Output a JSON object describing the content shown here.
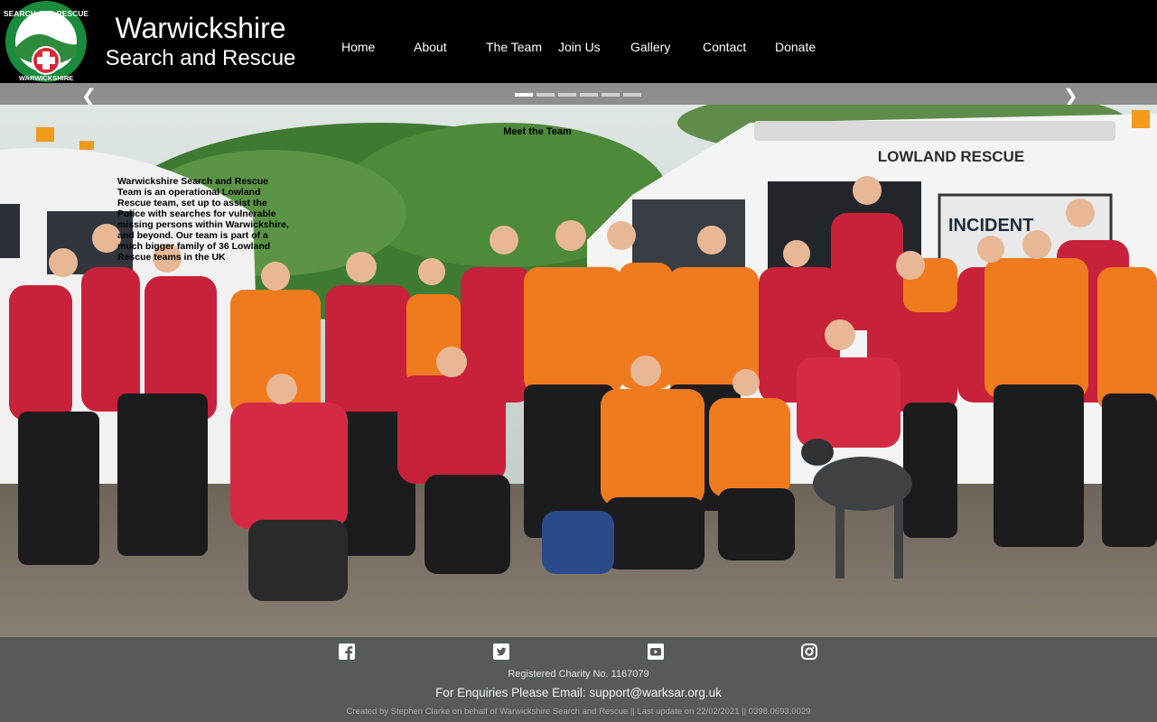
{
  "brand": {
    "line1": "Warwickshire",
    "line2": "Search and Rescue",
    "logo_icon": "search-and-rescue-warwickshire-logo",
    "logo_text_top": "SEARCH AND RESCUE",
    "logo_text_bottom": "WARWICKSHIRE"
  },
  "nav": [
    "Home",
    "About",
    "The Team",
    "Join Us",
    "Gallery",
    "Contact",
    "Donate"
  ],
  "slider": {
    "prev_icon": "chevron-left-icon",
    "next_icon": "chevron-right-icon",
    "slide_count": 6,
    "active_index": 0
  },
  "slide": {
    "title": "Meet the Team",
    "text": "Warwickshire Search and Rescue Team is an operational Lowland Rescue team, set up to assist the Police with searches for vulnerable missing persons within Warwickshire, and beyond. Our team is part of a much bigger family of 36 Lowland Rescue teams in the UK",
    "van_text": "LOWLAND RESCUE",
    "van_text2": "INCIDENT"
  },
  "footer": {
    "social": [
      "facebook-icon",
      "twitter-icon",
      "youtube-icon",
      "instagram-icon"
    ],
    "charity": "Registered Charity No. 1167079",
    "enquiries_prefix": "For Enquiries Please Email: ",
    "email": "support@warksar.org.uk",
    "credits": "Created by Stephen Clarke on behalf of Warwickshire Search and Rescue || Last update on 22/02/2021 || 0398.0693.0029"
  },
  "colors": {
    "header_bg": "#000000",
    "slider_bar": "#8e8e8e",
    "footer_bg": "#565b58",
    "jacket_red": "#c8213a",
    "hi_vis_orange": "#f07a1e"
  }
}
